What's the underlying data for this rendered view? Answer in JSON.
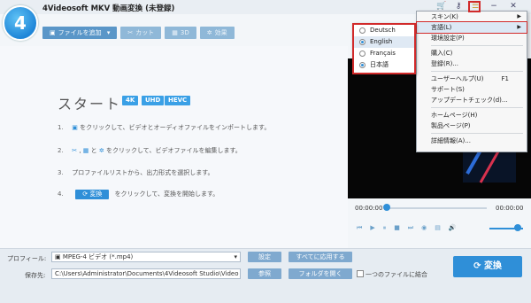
{
  "app": {
    "title": "4Videosoft MKV 動画変換 (未登録)",
    "logo_letter": "4"
  },
  "titlebar_icons": {
    "cart": "🛒",
    "key": "⚷",
    "menu": "☰",
    "minimize": "−",
    "close": "✕"
  },
  "toolbar": {
    "add_file": "ファイルを追加",
    "add_dropdown": "▾",
    "cut": "カット",
    "three_d": "3D",
    "effect": "効果"
  },
  "main": {
    "start_title": "スタート",
    "badges": [
      "4K",
      "UHD",
      "HEVC"
    ],
    "steps": [
      {
        "num": "1.",
        "text": "をクリックして、ビデオとオーディオファイルをインポートします。"
      },
      {
        "num": "2.",
        "text_and": "と",
        "text": "をクリックして、ビデオファイルを編集します。"
      },
      {
        "num": "3.",
        "text": "プロファイルリストから、出力形式を選択します。"
      },
      {
        "num": "4.",
        "convert_label": "変換",
        "text": "をクリックして、変換を開始します。"
      }
    ]
  },
  "player": {
    "time_start": "00:00:00",
    "time_end": "00:00:00"
  },
  "bottom": {
    "profile_label": "プロフィール:",
    "profile_value": "MPEG-4 ビデオ (*.mp4)",
    "settings": "設定",
    "apply_all": "すべてに応用する",
    "dest_label": "保存先:",
    "dest_value": "C:\\Users\\Administrator\\Documents\\4Videosoft Studio\\Video",
    "browse": "参照",
    "open_folder": "フォルダを開く",
    "merge_label": "一つのファイルに結合",
    "convert": "変換"
  },
  "menu": {
    "items": [
      {
        "label": "スキン(K)",
        "shortcut": "",
        "submenu": true
      },
      {
        "label": "言語(L)",
        "shortcut": "",
        "submenu": true,
        "highlight": true
      },
      {
        "label": "環境設定(P)",
        "shortcut": ""
      },
      {
        "sep": true
      },
      {
        "label": "購入(C)",
        "shortcut": ""
      },
      {
        "label": "登録(R)...",
        "shortcut": ""
      },
      {
        "sep": true
      },
      {
        "label": "ユーザーヘルプ(U)",
        "shortcut": "F1"
      },
      {
        "label": "サポート(S)",
        "shortcut": ""
      },
      {
        "label": "アップデートチェック(d)...",
        "shortcut": ""
      },
      {
        "sep": true
      },
      {
        "label": "ホームページ(H)",
        "shortcut": ""
      },
      {
        "label": "製品ページ(P)",
        "shortcut": ""
      },
      {
        "sep": true
      },
      {
        "label": "詳細情報(A)...",
        "shortcut": ""
      }
    ]
  },
  "languages": [
    {
      "label": "Deutsch",
      "checked": false
    },
    {
      "label": "English",
      "checked": true
    },
    {
      "label": "Français",
      "checked": false
    },
    {
      "label": "日本語",
      "checked": true
    }
  ],
  "colors": {
    "accent": "#2f8fd8",
    "highlight_border": "#d12a2a",
    "toolbar_btn": "#5a96c8"
  }
}
